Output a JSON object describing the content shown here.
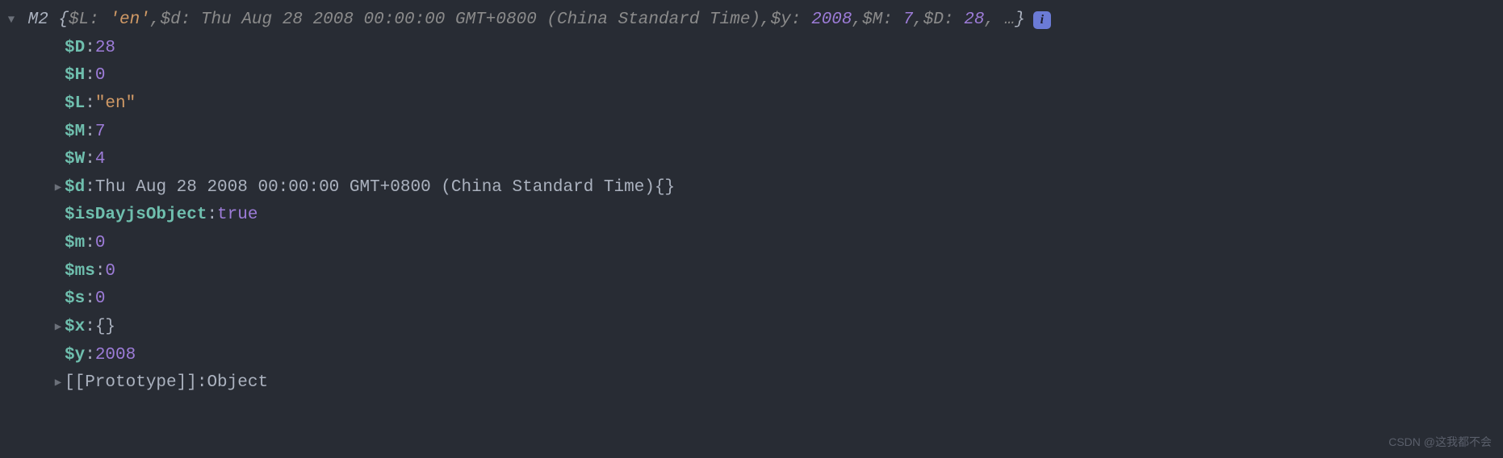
{
  "header": {
    "className": "M2",
    "preview": {
      "open": "{",
      "close": "}",
      "ellipsis": ", …",
      "items": [
        {
          "key": "$L",
          "sep": ": ",
          "type": "string",
          "value": "'en'"
        },
        {
          "key": "$d",
          "sep": ": ",
          "type": "text",
          "value": "Thu Aug 28 2008 00:00:00 GMT+0800 (China Standard Time)"
        },
        {
          "key": "$y",
          "sep": ": ",
          "type": "num",
          "value": "2008"
        },
        {
          "key": "$M",
          "sep": ": ",
          "type": "num",
          "value": "7"
        },
        {
          "key": "$D",
          "sep": ": ",
          "type": "num",
          "value": "28"
        }
      ]
    },
    "infoBadge": "i"
  },
  "props": [
    {
      "key": "$D",
      "valueType": "num",
      "value": "28",
      "expandable": false
    },
    {
      "key": "$H",
      "valueType": "num",
      "value": "0",
      "expandable": false
    },
    {
      "key": "$L",
      "valueType": "string",
      "value": "\"en\"",
      "expandable": false
    },
    {
      "key": "$M",
      "valueType": "num",
      "value": "7",
      "expandable": false
    },
    {
      "key": "$W",
      "valueType": "num",
      "value": "4",
      "expandable": false
    },
    {
      "key": "$d",
      "valueType": "date",
      "value": "Thu Aug 28 2008 00:00:00 GMT+0800 (China Standard Time)",
      "suffix": "{}",
      "expandable": true
    },
    {
      "key": "$isDayjsObject",
      "valueType": "num",
      "value": "true",
      "expandable": false
    },
    {
      "key": "$m",
      "valueType": "num",
      "value": "0",
      "expandable": false
    },
    {
      "key": "$ms",
      "valueType": "num",
      "value": "0",
      "expandable": false
    },
    {
      "key": "$s",
      "valueType": "num",
      "value": "0",
      "expandable": false
    },
    {
      "key": "$x",
      "valueType": "braces",
      "value": "{}",
      "expandable": true
    },
    {
      "key": "$y",
      "valueType": "num",
      "value": "2008",
      "expandable": false
    }
  ],
  "prototype": {
    "key": "[[Prototype]]",
    "value": "Object"
  },
  "watermark": "CSDN @这我都不会"
}
